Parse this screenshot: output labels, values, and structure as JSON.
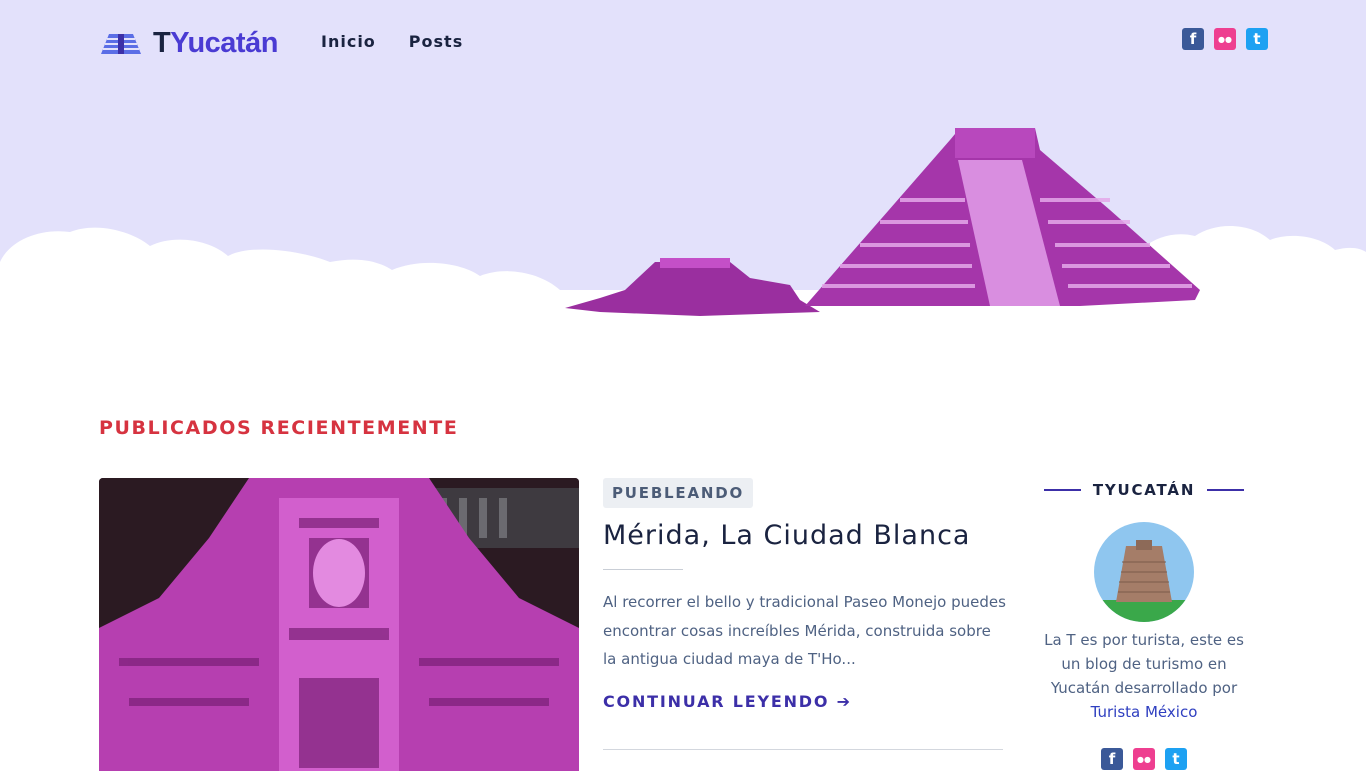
{
  "header": {
    "logo_initial": "T",
    "logo_rest": "Yucatán",
    "nav": [
      {
        "label": "Inicio"
      },
      {
        "label": "Posts"
      }
    ],
    "social": {
      "facebook_glyph": "f",
      "flickr_glyph": "●●",
      "twitter_glyph": "t"
    }
  },
  "colors": {
    "hero_bg": "#e3e1fb",
    "accent": "#3c2fa8",
    "section_title": "#d63340",
    "pyramid": "#b33bb3"
  },
  "main": {
    "section_title": "PUBLICADOS RECIENTEMENTE",
    "post": {
      "category": "PUEBLEANDO",
      "title": "Mérida, La Ciudad Blanca",
      "excerpt": "Al recorrer el bello y tradicional Paseo Monejo puedes encontrar cosas increíbles Mérida, construida sobre la antigua ciudad maya de T'Ho...",
      "read_more": "CONTINUAR LEYENDO",
      "read_more_icon": "arrow-right-icon"
    }
  },
  "sidebar": {
    "widget_title": "TYUCATÁN",
    "about_text": "La T es por turista, este es un blog de turismo en Yucatán desarrollado por",
    "about_link": "Turista México"
  }
}
